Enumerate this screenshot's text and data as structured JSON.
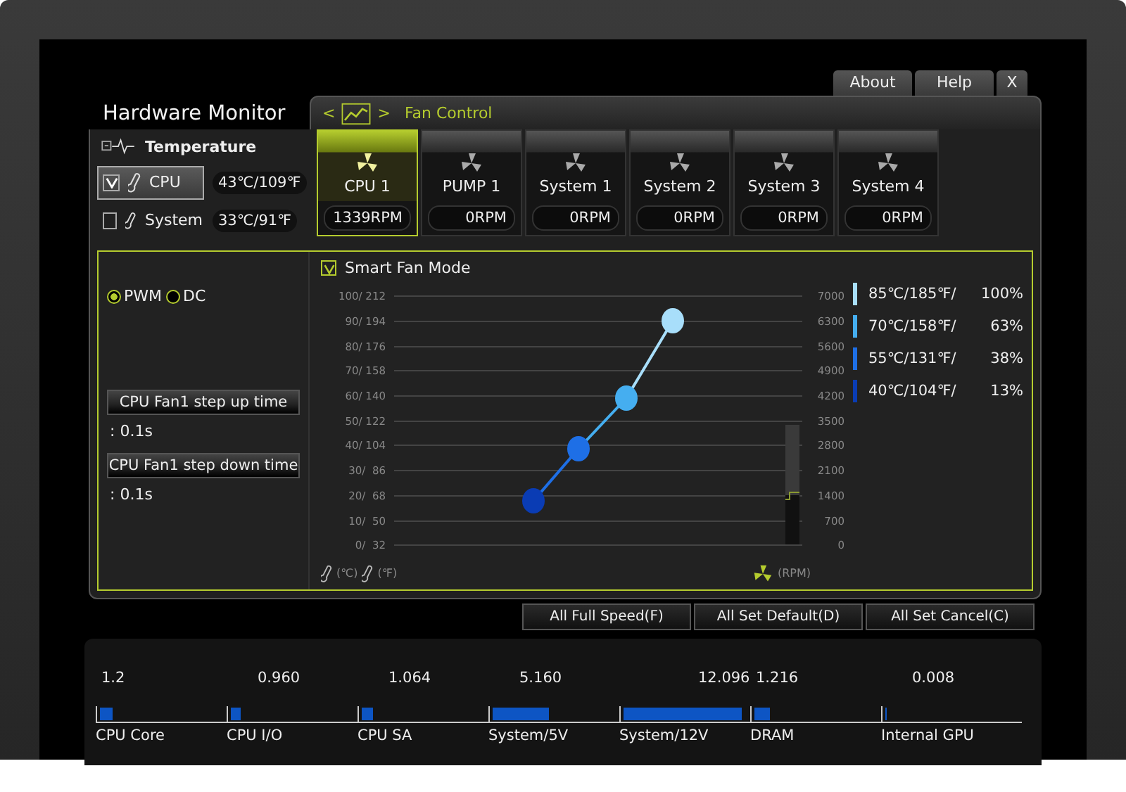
{
  "top_tabs": [
    "About",
    "Help",
    "X"
  ],
  "title": "Hardware Monitor",
  "section": {
    "prev": "<",
    "next": ">",
    "label": "Fan Control"
  },
  "temperature": {
    "label": "Temperature",
    "sensors": [
      {
        "name": "CPU",
        "value": "43℃/109℉",
        "checked": true,
        "selected": true
      },
      {
        "name": "System",
        "value": "33℃/91℉",
        "checked": false,
        "selected": false
      }
    ]
  },
  "fans": [
    {
      "name": "CPU 1",
      "rpm": "1339RPM",
      "selected": true
    },
    {
      "name": "PUMP 1",
      "rpm": "0RPM",
      "selected": false
    },
    {
      "name": "System 1",
      "rpm": "0RPM",
      "selected": false
    },
    {
      "name": "System 2",
      "rpm": "0RPM",
      "selected": false
    },
    {
      "name": "System 3",
      "rpm": "0RPM",
      "selected": false
    },
    {
      "name": "System 4",
      "rpm": "0RPM",
      "selected": false
    }
  ],
  "mode": [
    {
      "label": "PWM",
      "selected": true
    },
    {
      "label": "DC",
      "selected": false
    }
  ],
  "step_times": [
    {
      "label": "CPU Fan1 step up time",
      "value": ": 0.1s"
    },
    {
      "label": "CPU Fan1 step down time",
      "value": ": 0.1s"
    }
  ],
  "smart_fan": {
    "label": "Smart Fan Mode",
    "checked": true
  },
  "temp_axis": [
    "100/ 212",
    "90/ 194",
    "80/ 176",
    "70/ 158",
    "60/ 140",
    "50/ 122",
    "40/ 104",
    "30/  86",
    "20/  68",
    "10/  50",
    "0/  32"
  ],
  "rpm_axis": [
    "7000",
    "6300",
    "5600",
    "4900",
    "4200",
    "3500",
    "2800",
    "2100",
    "1400",
    "700",
    "0"
  ],
  "temp_units": [
    "(℃)",
    "(℉)"
  ],
  "rpm_unit": "(RPM)",
  "curve": [
    {
      "temp": "85℃/185℉/",
      "percent": "100%",
      "color": "#a8defa"
    },
    {
      "temp": "70℃/158℉/",
      "percent": "63%",
      "color": "#45aef0"
    },
    {
      "temp": "55℃/131℉/",
      "percent": "38%",
      "color": "#1e6fe6"
    },
    {
      "temp": "40℃/104℉/",
      "percent": "13%",
      "color": "#0a3cb4"
    }
  ],
  "buttons": [
    "All Full Speed(F)",
    "All Set Default(D)",
    "All Set Cancel(C)"
  ],
  "voltages": [
    {
      "label": "CPU Core",
      "value": "1.2",
      "level": 0.1
    },
    {
      "label": "CPU I/O",
      "value": "0.960",
      "level": 0.08
    },
    {
      "label": "CPU SA",
      "value": "1.064",
      "level": 0.09
    },
    {
      "label": "System/5V",
      "value": "5.160",
      "level": 0.45
    },
    {
      "label": "System/12V",
      "value": "12.096",
      "level": 0.95
    },
    {
      "label": "DRAM",
      "value": "1.216",
      "level": 0.12
    },
    {
      "label": "Internal GPU",
      "value": "0.008",
      "level": 0.01
    }
  ]
}
